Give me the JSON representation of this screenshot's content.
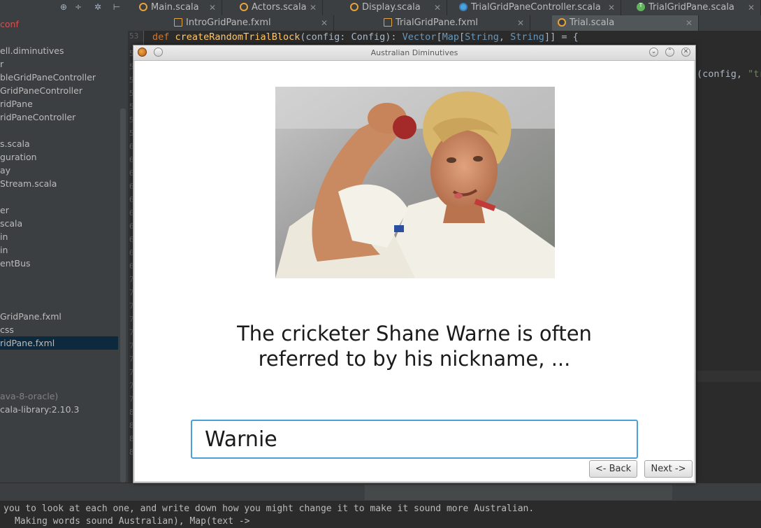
{
  "project_panel": {
    "items": [
      {
        "label": "conf",
        "style": "red"
      },
      {
        "label": ""
      },
      {
        "label": "ell.diminutives"
      },
      {
        "label": "r"
      },
      {
        "label": "bleGridPaneController"
      },
      {
        "label": "GridPaneController"
      },
      {
        "label": "ridPane"
      },
      {
        "label": "ridPaneController"
      },
      {
        "label": ""
      },
      {
        "label": "s.scala"
      },
      {
        "label": "guration"
      },
      {
        "label": "ay"
      },
      {
        "label": "Stream.scala"
      },
      {
        "label": ""
      },
      {
        "label": "er"
      },
      {
        "label": "scala"
      },
      {
        "label": "in"
      },
      {
        "label": "in"
      },
      {
        "label": "entBus"
      },
      {
        "label": ""
      },
      {
        "label": ""
      },
      {
        "label": ""
      },
      {
        "label": "GridPane.fxml"
      },
      {
        "label": "css"
      },
      {
        "label": "ridPane.fxml",
        "style": "selected"
      },
      {
        "label": ""
      },
      {
        "label": ""
      },
      {
        "label": ""
      },
      {
        "label": "ava-8-oracle)",
        "style": "grey"
      },
      {
        "label": "cala-library:2.10.3"
      }
    ]
  },
  "tabs": {
    "row1": [
      {
        "label": "Main.scala",
        "icon": "o"
      },
      {
        "label": "Actors.scala",
        "icon": "o"
      },
      {
        "label": "Display.scala",
        "icon": "o"
      },
      {
        "label": "TrialGridPaneController.scala",
        "icon": "c"
      },
      {
        "label": "TrialGridPane.scala",
        "icon": "t"
      }
    ],
    "row2": [
      {
        "label": "IntroGridPane.fxml",
        "icon": "fx"
      },
      {
        "label": "TrialGridPane.fxml",
        "icon": "fx"
      },
      {
        "label": "Trial.scala",
        "icon": "o",
        "active": true
      }
    ],
    "close_glyph": "✕"
  },
  "editor": {
    "line_number": "53",
    "gutter_digits": [
      "5",
      "5",
      "5",
      "5",
      "5",
      "5",
      "5",
      "6",
      "6",
      "6",
      "6",
      "6",
      "6",
      "6",
      "6",
      "6",
      "6",
      "7",
      "7",
      "7",
      "7",
      "7",
      "7",
      "7",
      "7",
      "7",
      "7",
      "8",
      "8",
      "8",
      "8"
    ],
    "code": {
      "kw": "def",
      "fn": "createRandomTrialBlock",
      "rest1": "(config: Config): ",
      "ty1": "Vector",
      "rest2": "[",
      "ty2": "Map",
      "rest3": "[",
      "ty3": "String",
      "rest4": ", ",
      "ty4": "String",
      "rest5": "]] = {"
    },
    "code_right": {
      "text": "(config, ",
      "str": "\"tr"
    }
  },
  "console": {
    "line1": "you to look at each one, and write down how you might change it to make it sound more Australian.",
    "line2": "Making words sound Australian), Map(text ->"
  },
  "dialog": {
    "title": "Australian Diminutives",
    "question_line1": "The cricketer Shane Warne is often",
    "question_line2": "referred to by his nickname, ...",
    "answer_value": "Warnie",
    "back_label": "<- Back",
    "next_label": "Next ->",
    "btn_minimize": "⌄",
    "btn_maximize": "⌃",
    "btn_close": "✕"
  },
  "colors": {
    "ide_bg": "#2b2b2b",
    "panel_bg": "#3c3f41",
    "selection": "#0d293e",
    "input_focus": "#4aa0d9"
  }
}
